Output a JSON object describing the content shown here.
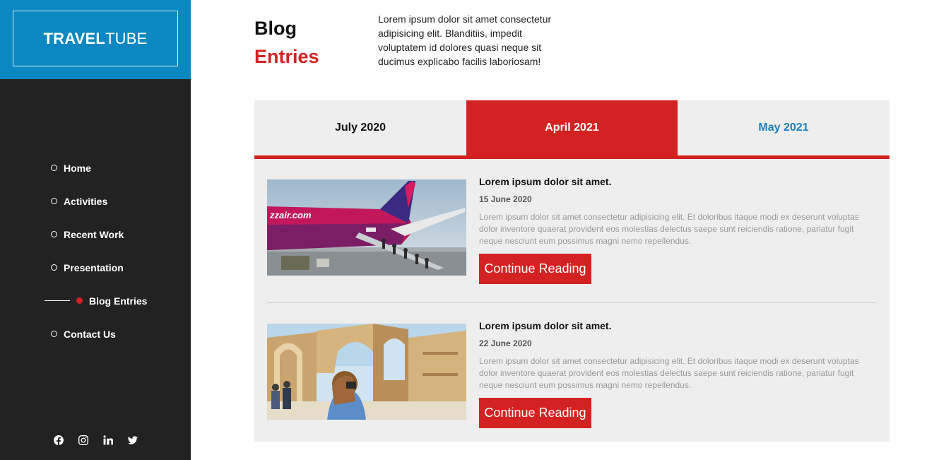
{
  "sidebar": {
    "logo_bold": "TRAVEL",
    "logo_light": "TUBE",
    "nav": [
      {
        "label": "Home"
      },
      {
        "label": "Activities"
      },
      {
        "label": "Recent Work"
      },
      {
        "label": "Presentation"
      },
      {
        "label": "Blog Entries",
        "active": true
      },
      {
        "label": "Contact Us"
      }
    ],
    "socials": [
      "facebook-icon",
      "instagram-icon",
      "linkedin-icon",
      "twitter-icon"
    ]
  },
  "header": {
    "title_line1": "Blog",
    "title_line2": "Entries",
    "intro": "Lorem ipsum dolor sit amet consectetur adipisicing elit. Blanditiis, impedit voluptatem id dolores quasi neque sit ducimus explicabo facilis laboriosam!"
  },
  "tabs": [
    {
      "label": "July 2020"
    },
    {
      "label": "April 2021",
      "active": true
    },
    {
      "label": "May 2021"
    }
  ],
  "entries": [
    {
      "title": "Lorem ipsum dolor sit amet.",
      "date": "15 June 2020",
      "excerpt": "Lorem ipsum dolor sit amet consectetur adipisicing elit. Et doloribus itaque modi ex deserunt voluptas dolor inventore quaerat provident eos molestias delectus saepe sunt reiciendis ratione, pariatur fugit neque nesciunt eum possimus magni nemo repellendus.",
      "button": "Continue Reading",
      "image_text": "zzair.com"
    },
    {
      "title": "Lorem ipsum dolor sit amet.",
      "date": "22 June 2020",
      "excerpt": "Lorem ipsum dolor sit amet consectetur adipisicing elit. Et doloribus itaque modi ex deserunt voluptas dolor inventore quaerat provident eos molestias delectus saepe sunt reiciendis ratione, pariatur fugit neque nesciunt eum possimus magni nemo repellendus.",
      "button": "Continue Reading"
    }
  ],
  "colors": {
    "brand_blue": "#0b87c1",
    "accent_red": "#d42222",
    "sidebar_bg": "#222222",
    "panel_bg": "#eeeeee",
    "tab_blue_text": "#1f7fbc"
  }
}
